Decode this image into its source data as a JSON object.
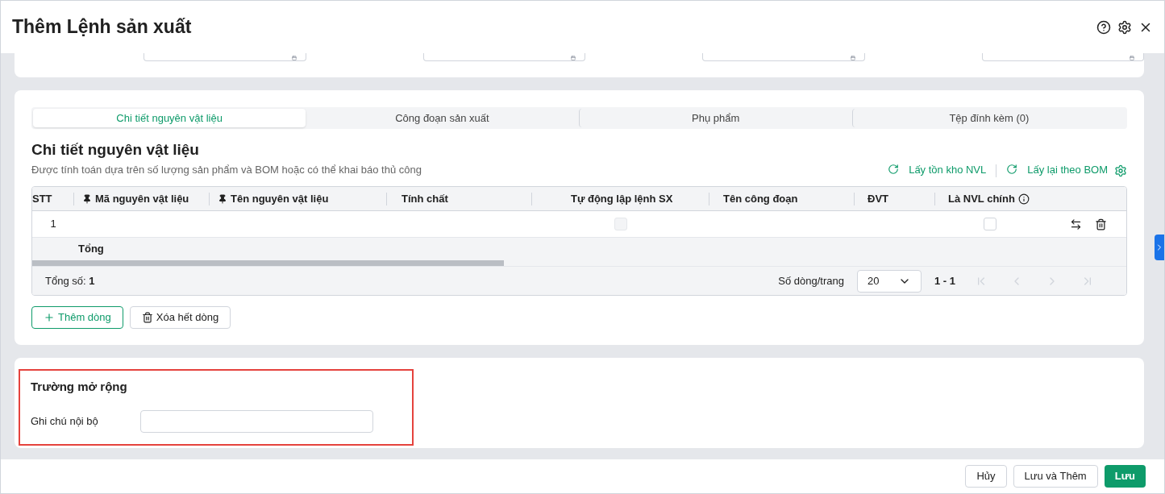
{
  "window": {
    "title": "Thêm Lệnh sản xuất"
  },
  "tabs": [
    {
      "label": "Chi tiết nguyên vật liệu",
      "selected": true
    },
    {
      "label": "Công đoạn sản xuất",
      "selected": false
    },
    {
      "label": "Phụ phẩm",
      "selected": false
    },
    {
      "label": "Tệp đính kèm (0)",
      "selected": false
    }
  ],
  "section": {
    "title": "Chi tiết nguyên vật liệu",
    "subtitle": "Được tính toán dựa trên số lượng sản phẩm và BOM hoặc có thể khai báo thủ công",
    "actions": [
      "Lấy tồn kho NVL",
      "Lấy lại theo BOM"
    ]
  },
  "table": {
    "columns": [
      {
        "label": "STT",
        "pinned": false,
        "info": false
      },
      {
        "label": "Mã nguyên vật liệu",
        "pinned": true,
        "info": false
      },
      {
        "label": "Tên nguyên vật liệu",
        "pinned": true,
        "info": false
      },
      {
        "label": "Tính chất",
        "pinned": false,
        "info": false
      },
      {
        "label": "Tự động lập lệnh SX",
        "pinned": false,
        "info": false
      },
      {
        "label": "Tên công đoạn",
        "pinned": false,
        "info": false
      },
      {
        "label": "ĐVT",
        "pinned": false,
        "info": false
      },
      {
        "label": "Là NVL chính",
        "pinned": false,
        "info": true
      }
    ],
    "rows": [
      {
        "stt": "1",
        "auto_order": {
          "checked": false,
          "disabled": true
        },
        "main_material": {
          "checked": false,
          "disabled": false
        }
      }
    ],
    "total_label": "Tổng",
    "footer": {
      "count_label": "Tổng số:",
      "count": "1",
      "page_size_label": "Số dòng/trang",
      "page_size": "20",
      "range": "1 - 1"
    }
  },
  "row_buttons": [
    "Thêm dòng",
    "Xóa hết dòng"
  ],
  "extension": {
    "title": "Trường mở rộng",
    "fields": [
      {
        "label": "Ghi chú nội bộ"
      }
    ]
  },
  "footer_buttons": [
    {
      "label": "Hủy",
      "primary": false
    },
    {
      "label": "Lưu và Thêm",
      "primary": false
    },
    {
      "label": "Lưu",
      "primary": true
    }
  ]
}
